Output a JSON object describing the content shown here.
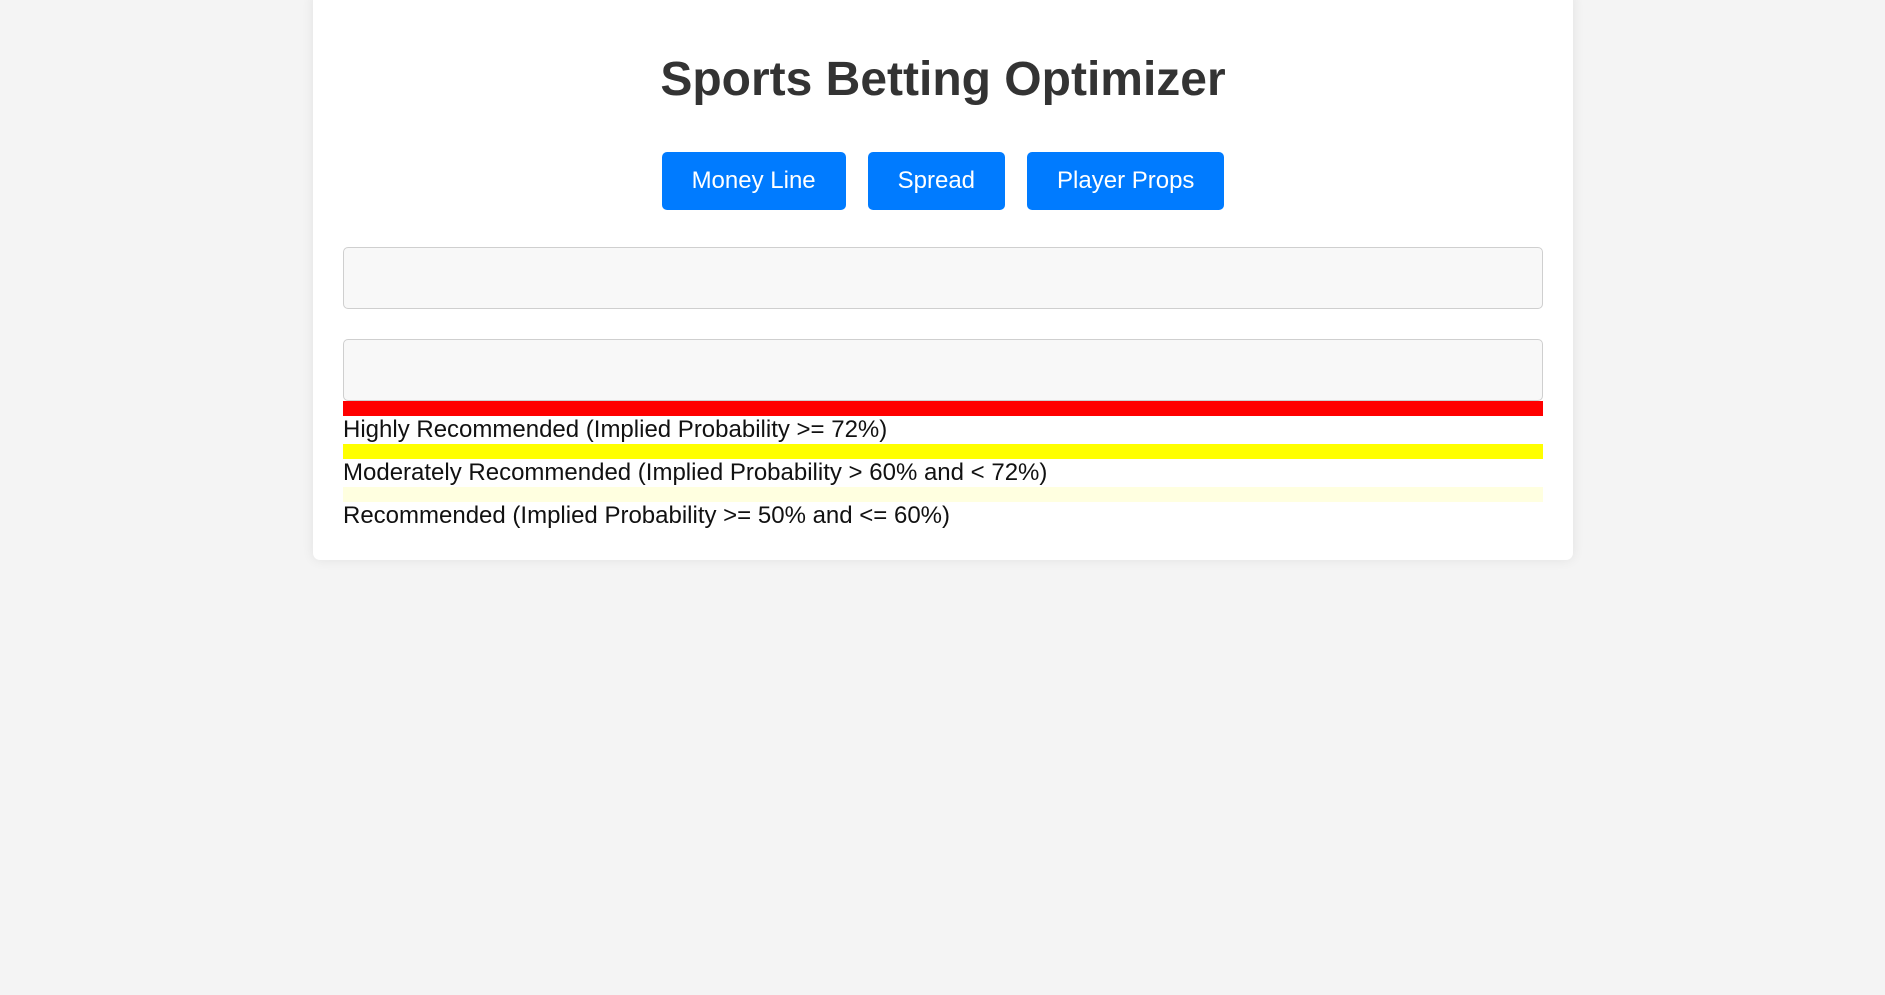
{
  "header": {
    "title": "Sports Betting Optimizer"
  },
  "tabs": [
    {
      "label": "Money Line"
    },
    {
      "label": "Spread"
    },
    {
      "label": "Player Props"
    }
  ],
  "inputs": {
    "first": {
      "value": "",
      "placeholder": ""
    },
    "second": {
      "value": "",
      "placeholder": ""
    }
  },
  "legend": [
    {
      "color": "#ff0000",
      "label": "Highly Recommended (Implied Probability >= 72%)"
    },
    {
      "color": "#ffff00",
      "label": "Moderately Recommended (Implied Probability > 60% and < 72%)"
    },
    {
      "color": "#ffffe0",
      "label": "Recommended (Implied Probability >= 50% and <= 60%)"
    }
  ],
  "colors": {
    "accent": "#007bff",
    "page_background": "#f4f4f4",
    "card_background": "#ffffff",
    "title_text": "#333333"
  }
}
